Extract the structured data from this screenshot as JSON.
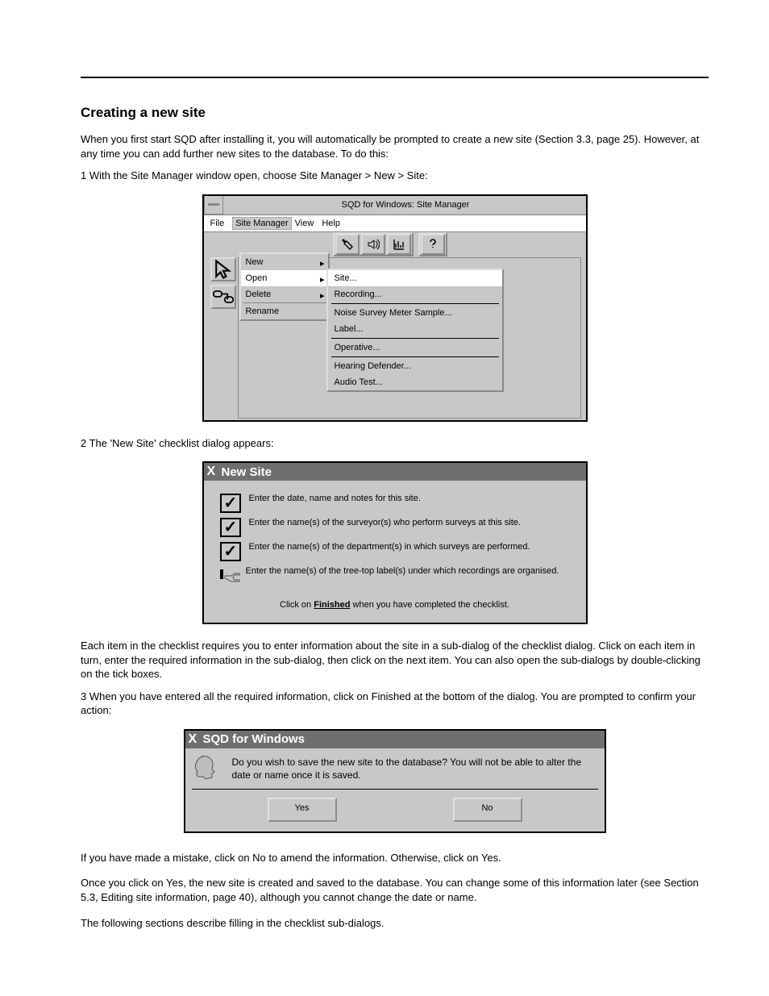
{
  "doc": {
    "section_title": "Creating a new site",
    "intro": "When you first start SQD after installing it, you will automatically be prompted to create a new site (Section 3.3, page 25). However, at any time you can add further new sites to the database. To do this:",
    "steps": [
      "1  With the Site Manager window open, choose Site Manager > New > Site:",
      "2  The 'New Site' checklist dialog appears:"
    ]
  },
  "appwin": {
    "title": "SQD for Windows: Site Manager",
    "menubar": [
      "File",
      "Site Manager",
      "View",
      "Help"
    ],
    "toolbar_icons": [
      "spray-icon",
      "audio-icon",
      "chart-icon",
      "help-icon"
    ],
    "palette_icons": [
      "pointer-icon",
      "link-icon"
    ],
    "menu1": {
      "items": [
        {
          "label": "New",
          "sub": true
        },
        {
          "label": "Open",
          "sub": true,
          "hl": true
        },
        {
          "label": "Delete",
          "sub": true
        },
        {
          "label": "Rename"
        }
      ]
    },
    "menu2": {
      "items": [
        {
          "label": "Site...",
          "hl": true
        },
        {
          "label": "Recording..."
        },
        {
          "label": "Noise Survey Meter Sample..."
        },
        {
          "label": "Label..."
        },
        {
          "label": "Operative...",
          "sep_before": true
        },
        {
          "label": "Hearing Defender...",
          "sep_before": true
        },
        {
          "label": "Audio Test...",
          "sub_line": true
        }
      ]
    }
  },
  "dlg2": {
    "title": "New Site",
    "rows": [
      "Enter the date, name and notes for this site.",
      "Enter the name(s) of the surveyor(s) who perform surveys at this site.",
      "Enter the name(s) of the department(s) in which surveys are performed.",
      "Enter the name(s) of the tree-top label(s) under which recordings are organised."
    ],
    "finished_prefix": "Click on ",
    "finished_link": "Finished",
    "finished_suffix": " when you have completed the checklist."
  },
  "para_mid": "Each item in the checklist requires you to enter information about the site in a sub-dialog of the checklist dialog. Click on each item in turn, enter the required information in the sub-dialog, then click on the next item. You can also open the sub-dialogs by double-clicking on the tick boxes.",
  "step3": "3  When you have entered all the required information, click on Finished at the bottom of the dialog. You are prompted to confirm your action:",
  "dlg3": {
    "title": "SQD for Windows",
    "message": "Do you wish to save the new site to the database? You will not be able to alter the date or name once it is saved.",
    "buttons": [
      "Yes",
      "No"
    ]
  },
  "after": [
    "If you have made a mistake, click on No to amend the information. Otherwise, click on Yes.",
    "Once you click on Yes, the new site is created and saved to the database. You can change some of this information later (see Section 5.3, Editing site information, page 40), although you cannot change the date or name.",
    "The following sections describe filling in the checklist sub-dialogs."
  ]
}
